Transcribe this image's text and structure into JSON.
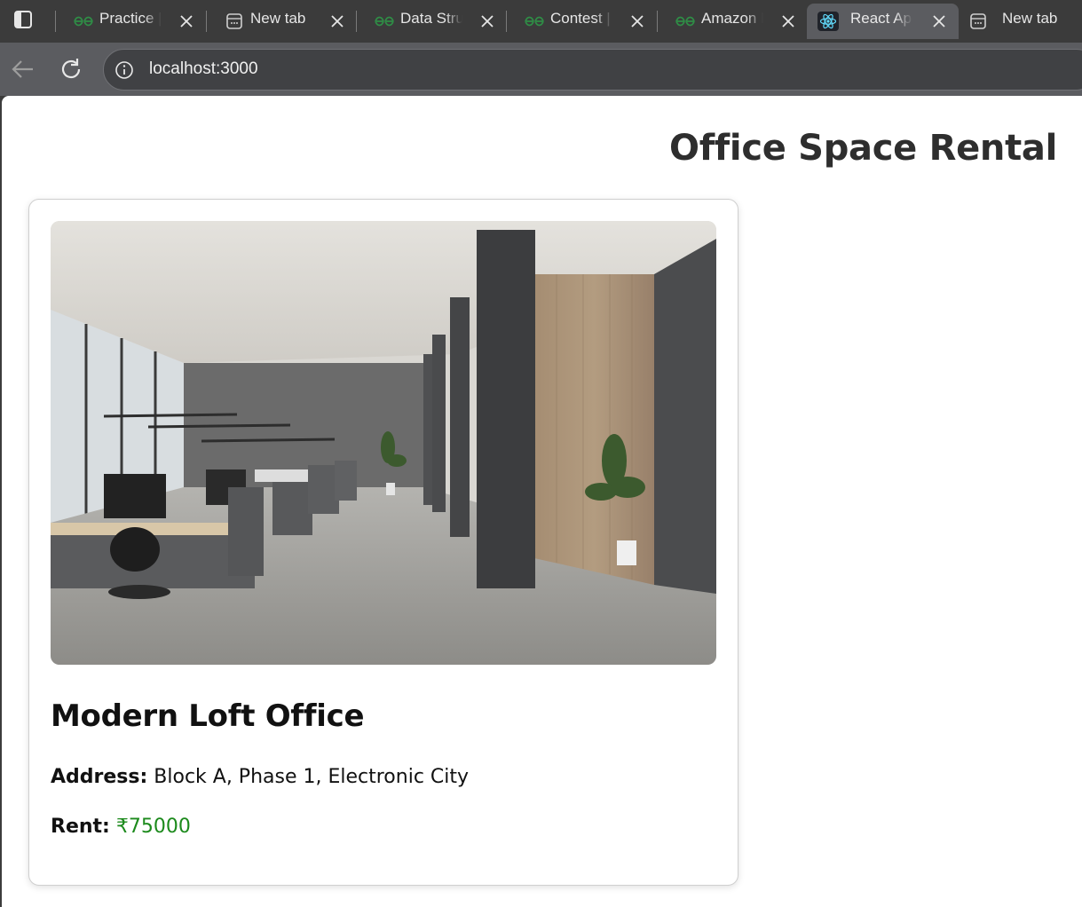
{
  "browser": {
    "tabs": [
      {
        "title": "Practice | GeeksforGeeks",
        "favicon": "gfg-icon",
        "active": false
      },
      {
        "title": "New tab",
        "favicon": "new-tab-icon",
        "active": false
      },
      {
        "title": "Data Structures",
        "favicon": "gfg-icon",
        "active": false
      },
      {
        "title": "Contest | GeeksforGeeks",
        "favicon": "gfg-icon",
        "active": false
      },
      {
        "title": "Amazon Mock",
        "favicon": "gfg-icon",
        "active": false
      },
      {
        "title": "React App",
        "favicon": "react-icon",
        "active": true
      },
      {
        "title": "New tab",
        "favicon": "new-tab-icon",
        "active": false
      }
    ],
    "url": "localhost:3000"
  },
  "page": {
    "title": "Office Space Rental",
    "office": {
      "name": "Modern Loft Office",
      "address_label": "Address:",
      "address": "Block A, Phase 1, Electronic City",
      "rent_label": "Rent:",
      "rent": "₹75000",
      "image": "office-interior-photo"
    }
  },
  "colors": {
    "rent_value": "#1c8a1c",
    "gfg_green": "#2f8d46",
    "react_blue": "#61dafb"
  }
}
